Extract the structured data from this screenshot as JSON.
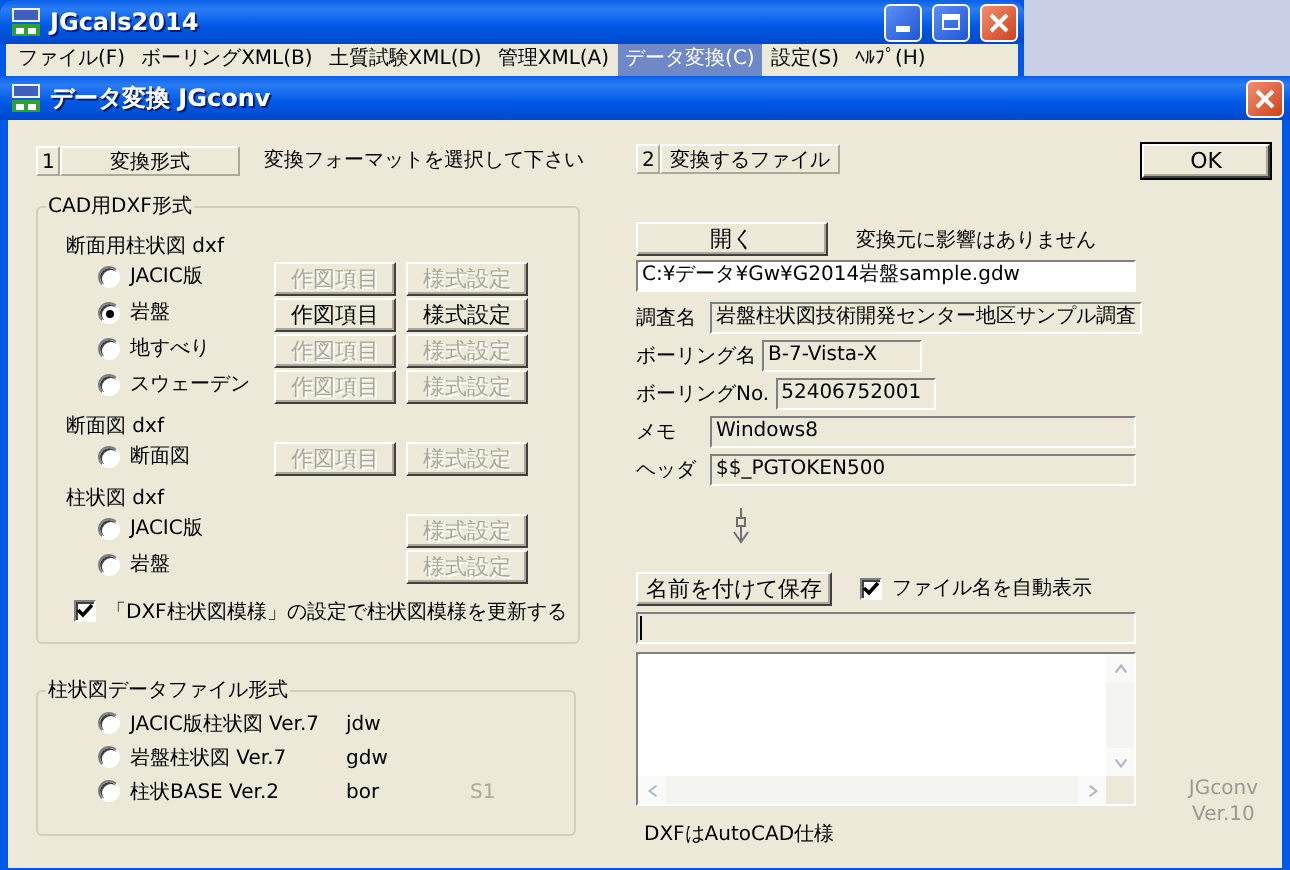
{
  "app_window": {
    "title": "JGcals2014",
    "menu": [
      {
        "label": "ファイル(F)",
        "selected": false
      },
      {
        "label": "ボーリングXML(B)",
        "selected": false
      },
      {
        "label": "土質試験XML(D)",
        "selected": false
      },
      {
        "label": "管理XML(A)",
        "selected": false
      },
      {
        "label": "データ変換(C)",
        "selected": true
      },
      {
        "label": "設定(S)",
        "selected": false
      },
      {
        "label": "ﾍﾙﾌﾟ(H)",
        "selected": false
      }
    ]
  },
  "dialog": {
    "title": "データ変換 JGconv",
    "format_step": {
      "number": "1",
      "label": "変換形式",
      "hint": "変換フォーマットを選択して下さい"
    },
    "cad_group": {
      "title": "CAD用DXF形式",
      "sections": [
        {
          "title": "断面用柱状図 dxf",
          "options": [
            {
              "label": "JACIC版",
              "selected": false,
              "buttons": [
                {
                  "label": "作図項目",
                  "disabled": true
                },
                {
                  "label": "様式設定",
                  "disabled": true
                }
              ]
            },
            {
              "label": "岩盤",
              "selected": true,
              "buttons": [
                {
                  "label": "作図項目",
                  "disabled": false
                },
                {
                  "label": "様式設定",
                  "disabled": false
                }
              ]
            },
            {
              "label": "地すべり",
              "selected": false,
              "buttons": [
                {
                  "label": "作図項目",
                  "disabled": true
                },
                {
                  "label": "様式設定",
                  "disabled": true
                }
              ]
            },
            {
              "label": "スウェーデン",
              "selected": false,
              "buttons": [
                {
                  "label": "作図項目",
                  "disabled": true
                },
                {
                  "label": "様式設定",
                  "disabled": true
                }
              ]
            }
          ]
        },
        {
          "title": "断面図 dxf",
          "options": [
            {
              "label": "断面図",
              "selected": false,
              "buttons": [
                {
                  "label": "作図項目",
                  "disabled": true
                },
                {
                  "label": "様式設定",
                  "disabled": true
                }
              ]
            }
          ]
        },
        {
          "title": "柱状図 dxf",
          "options": [
            {
              "label": "JACIC版",
              "selected": false,
              "buttons": [
                {
                  "label": "様式設定",
                  "disabled": true
                }
              ]
            },
            {
              "label": "岩盤",
              "selected": false,
              "buttons": [
                {
                  "label": "様式設定",
                  "disabled": true
                }
              ]
            }
          ]
        }
      ],
      "update_checkbox": {
        "label": "「DXF柱状図模様」の設定で柱状図模様を更新する",
        "checked": true
      }
    },
    "data_group": {
      "title": "柱状図データファイル形式",
      "options": [
        {
          "label": "JACIC版柱状図 Ver.7",
          "extension": "jdw",
          "selected": false
        },
        {
          "label": "岩盤柱状図 Ver.7",
          "extension": "gdw",
          "selected": false
        },
        {
          "label": "柱状BASE Ver.2",
          "extension": "bor",
          "selected": false
        }
      ],
      "code": "S1"
    },
    "file_step": {
      "number": "2",
      "label": "変換するファイル"
    },
    "ok_button": "OK",
    "open_button": "開く",
    "open_note": "変換元に影響はありません",
    "source_path": "C:¥データ¥Gw¥G2014岩盤sample.gdw",
    "fields": [
      {
        "label": "調査名",
        "value": "岩盤柱状図技術開発センター地区サンプル調査",
        "kind": "long"
      },
      {
        "label": "ボーリング名",
        "value": "B-7-Vista-X",
        "kind": "short"
      },
      {
        "label": "ボーリングNo.",
        "value": "52406752001",
        "kind": "short"
      },
      {
        "label": "メモ",
        "value": "Windows8",
        "kind": "long"
      },
      {
        "label": "ヘッダ",
        "value": "$$_PGTOKEN500",
        "kind": "long"
      }
    ],
    "save_button": "名前を付けて保存",
    "auto_name_checkbox": {
      "label": "ファイル名を自動表示",
      "checked": true
    },
    "footer_note": "DXFはAutoCAD仕様",
    "version": {
      "name": "JGconv",
      "number": "Ver.10"
    }
  }
}
